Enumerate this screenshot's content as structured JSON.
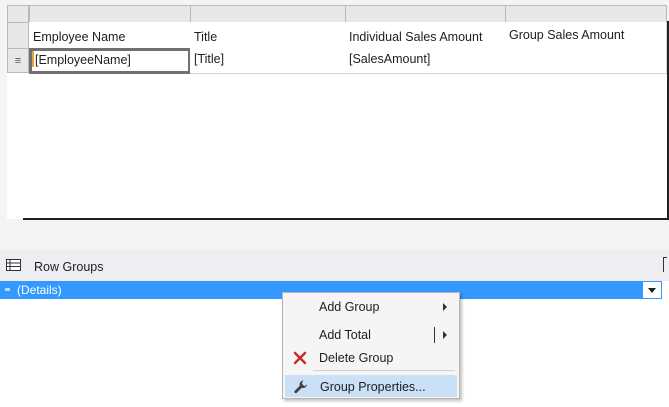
{
  "tablix": {
    "headers": [
      "Employee Name",
      "Title",
      "Individual Sales Amount",
      "Group Sales Amount"
    ],
    "details": [
      "[EmployeeName]",
      "[Title]",
      "[SalesAmount]",
      ""
    ],
    "details_row_handle": "≡"
  },
  "row_groups": {
    "title": "Row Groups",
    "details_label": "(Details)"
  },
  "context_menu": {
    "items": [
      {
        "label": "Add Group",
        "icon": "",
        "submenu": true
      },
      {
        "label": "Add Total",
        "icon": "",
        "submenu": true
      },
      {
        "label": "Delete Group",
        "icon": "red-x-icon",
        "submenu": false
      },
      {
        "label": "Group Properties...",
        "icon": "wrench-icon",
        "submenu": false
      }
    ]
  },
  "colors": {
    "selection": "#3399ff",
    "menu_hover": "#c9e0f7",
    "delete_red": "#c4302b"
  }
}
